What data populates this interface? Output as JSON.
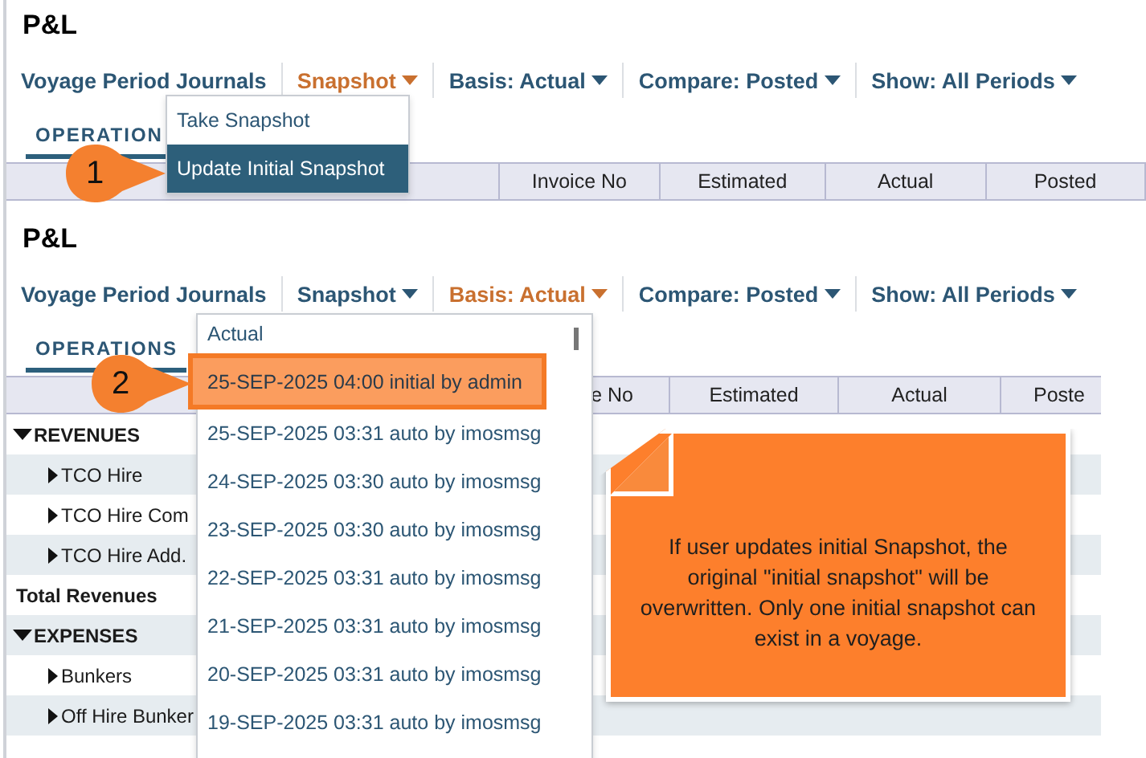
{
  "panels": [
    {
      "title": "P&L",
      "step": "1",
      "nav": [
        {
          "label": "Voyage Period Journals",
          "selected": false
        },
        {
          "label": "Snapshot",
          "selected": true
        },
        {
          "label": "Basis: Actual",
          "selected": false
        },
        {
          "label": "Compare: Posted",
          "selected": false
        },
        {
          "label": "Show: All Periods",
          "selected": false
        }
      ],
      "tabs": [
        {
          "label": "OPERATION",
          "selected": true
        }
      ],
      "columns": [
        "Invoice No",
        "Estimated",
        "Actual",
        "Posted"
      ],
      "menu": [
        {
          "label": "Take Snapshot",
          "selected": false
        },
        {
          "label": "Update Initial Snapshot",
          "selected": true
        }
      ]
    },
    {
      "title": "P&L",
      "step": "2",
      "nav": [
        {
          "label": "Voyage Period Journals",
          "selected": false
        },
        {
          "label": "Snapshot",
          "selected": false
        },
        {
          "label": "Basis: Actual",
          "selected": true
        },
        {
          "label": "Compare: Posted",
          "selected": false
        },
        {
          "label": "Show: All Periods",
          "selected": false
        }
      ],
      "tabs": [
        {
          "label": "OPERATIONS",
          "selected": true
        }
      ],
      "columns": [
        "e No",
        "Estimated",
        "Actual",
        "Poste"
      ],
      "menu": [
        {
          "label": "Actual",
          "selected": false
        },
        {
          "label": "25-SEP-2025 04:00 initial by admin",
          "selected": true
        },
        {
          "label": "25-SEP-2025 03:31 auto by imosmsg",
          "selected": false
        },
        {
          "label": "24-SEP-2025 03:30 auto by imosmsg",
          "selected": false
        },
        {
          "label": "23-SEP-2025 03:30 auto by imosmsg",
          "selected": false
        },
        {
          "label": "22-SEP-2025 03:31 auto by imosmsg",
          "selected": false
        },
        {
          "label": "21-SEP-2025 03:31 auto by imosmsg",
          "selected": false
        },
        {
          "label": "20-SEP-2025 03:31 auto by imosmsg",
          "selected": false
        },
        {
          "label": "19-SEP-2025 03:31 auto by imosmsg",
          "selected": false
        }
      ],
      "rows": [
        {
          "kind": "section",
          "label": "REVENUES",
          "expanded": true
        },
        {
          "kind": "item",
          "label": "TCO Hire",
          "expanded": false
        },
        {
          "kind": "item",
          "label": "TCO Hire Com",
          "expanded": false
        },
        {
          "kind": "item",
          "label": "TCO Hire Add.",
          "expanded": false
        },
        {
          "kind": "total",
          "label": "Total Revenues"
        },
        {
          "kind": "section",
          "label": "EXPENSES",
          "expanded": true
        },
        {
          "kind": "item",
          "label": "Bunkers",
          "expanded": false
        },
        {
          "kind": "item",
          "label": "Off Hire Bunker",
          "expanded": false
        }
      ],
      "note": "If user updates initial Snapshot, the original \"initial snapshot\" will be overwritten. Only one initial snapshot can exist in a voyage."
    }
  ]
}
